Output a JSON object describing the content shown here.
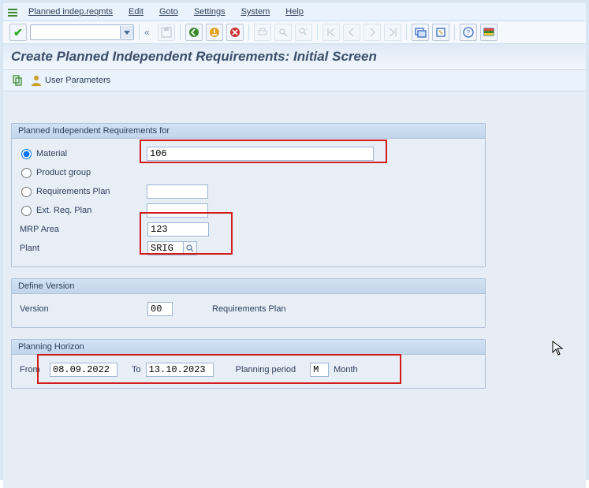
{
  "menu": {
    "items": [
      "Planned indep.reqmts",
      "Edit",
      "Goto",
      "Settings",
      "System",
      "Help"
    ]
  },
  "chevron_left": "«",
  "screen_title": "Create Planned Independent Requirements: Initial Screen",
  "subtoolbar": {
    "user_params": "User Parameters"
  },
  "panel_for": {
    "title": "Planned Independent Requirements for",
    "opt_material": "Material",
    "opt_product_group": "Product group",
    "opt_req_plan": "Requirements Plan",
    "opt_ext_req_plan": "Ext. Req. Plan",
    "lbl_mrp_area": "MRP Area",
    "lbl_plant": "Plant",
    "val_material": "106",
    "val_mrp_area": "123",
    "val_plant": "SRIG"
  },
  "panel_version": {
    "title": "Define Version",
    "lbl_version": "Version",
    "val_version": "00",
    "lbl_req_plan": "Requirements Plan"
  },
  "panel_horizon": {
    "title": "Planning Horizon",
    "lbl_from": "From",
    "val_from": "08.09.2022",
    "lbl_to": "To",
    "val_to": "13.10.2023",
    "lbl_period": "Planning period",
    "val_period_code": "M",
    "val_period_text": "Month"
  }
}
